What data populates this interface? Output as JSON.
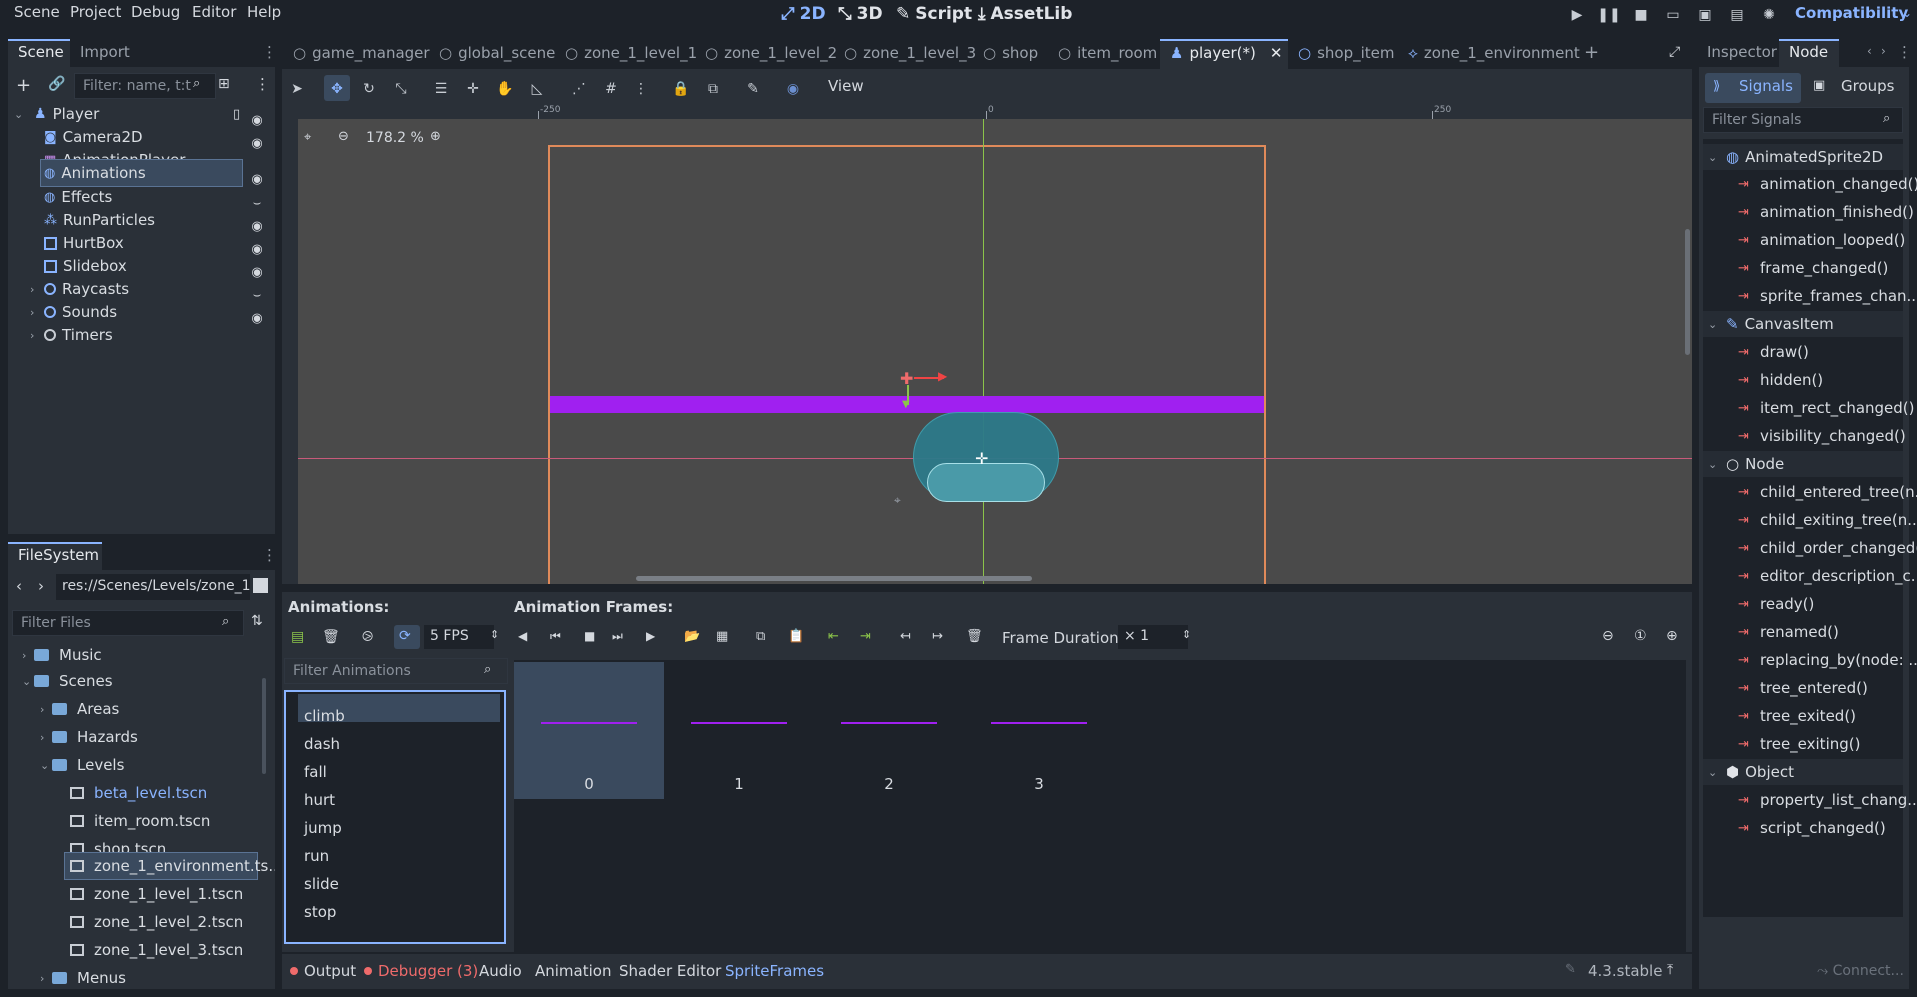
{
  "menu": [
    "Scene",
    "Project",
    "Debug",
    "Editor",
    "Help"
  ],
  "workspaces": [
    {
      "label": "2D",
      "icon": "2d-icon",
      "active": true
    },
    {
      "label": "3D",
      "icon": "3d-icon",
      "active": false
    },
    {
      "label": "Script",
      "icon": "script-icon",
      "active": false
    },
    {
      "label": "AssetLib",
      "icon": "assetlib-icon",
      "active": false
    }
  ],
  "renderer": "Compatibility",
  "scene_dock": {
    "tabs": [
      "Scene",
      "Import"
    ],
    "filter_placeholder": "Filter: name, t:t",
    "nodes": [
      {
        "label": "Player",
        "icon": "character-icon"
      },
      {
        "label": "Camera2D",
        "icon": "camera-icon"
      },
      {
        "label": "AnimationPlayer",
        "icon": "animation-player-icon"
      },
      {
        "label": "Animations",
        "icon": "animated-sprite-icon"
      },
      {
        "label": "Effects",
        "icon": "animated-sprite-icon"
      },
      {
        "label": "RunParticles",
        "icon": "particles-icon"
      },
      {
        "label": "HurtBox",
        "icon": "area-icon"
      },
      {
        "label": "Slidebox",
        "icon": "area-icon"
      },
      {
        "label": "Raycasts",
        "icon": "node-icon"
      },
      {
        "label": "Sounds",
        "icon": "node-icon"
      },
      {
        "label": "Timers",
        "icon": "node-icon"
      }
    ]
  },
  "filesystem": {
    "tab": "FileSystem",
    "path": "res://Scenes/Levels/zone_1",
    "filter_placeholder": "Filter Files",
    "items": [
      {
        "label": "Music",
        "type": "folder"
      },
      {
        "label": "Scenes",
        "type": "folder"
      },
      {
        "label": "Areas",
        "type": "folder"
      },
      {
        "label": "Hazards",
        "type": "folder"
      },
      {
        "label": "Levels",
        "type": "folder"
      },
      {
        "label": "beta_level.tscn",
        "type": "scene"
      },
      {
        "label": "item_room.tscn",
        "type": "scene"
      },
      {
        "label": "shop.tscn",
        "type": "scene"
      },
      {
        "label": "zone_1_environment.ts...",
        "type": "scene"
      },
      {
        "label": "zone_1_level_1.tscn",
        "type": "scene"
      },
      {
        "label": "zone_1_level_2.tscn",
        "type": "scene"
      },
      {
        "label": "zone_1_level_3.tscn",
        "type": "scene"
      },
      {
        "label": "Menus",
        "type": "folder"
      }
    ]
  },
  "scene_tabs": [
    "game_manager",
    "global_scene",
    "zone_1_level_1",
    "zone_1_level_2",
    "zone_1_level_3",
    "shop",
    "item_room",
    "player(*)",
    "shop_item",
    "zone_1_environment"
  ],
  "viewport": {
    "zoom": "178.2 %",
    "view_label": "View",
    "ruler_labels": [
      "-250",
      "0",
      "250"
    ]
  },
  "sprite_frames": {
    "animations_title": "Animations:",
    "frames_title": "Animation Frames:",
    "fps": "5 FPS",
    "filter_placeholder": "Filter Animations",
    "frame_duration_label": "Frame Duration:",
    "frame_duration_value": "× 1",
    "animations": [
      "climb",
      "dash",
      "fall",
      "hurt",
      "jump",
      "run",
      "slide",
      "stop"
    ],
    "frames": [
      "0",
      "1",
      "2",
      "3"
    ]
  },
  "bottom_tabs": [
    "Output",
    "Debugger (3)",
    "Audio",
    "Animation",
    "Shader Editor",
    "SpriteFrames"
  ],
  "version": "4.3.stable",
  "inspector": {
    "tabs": [
      "Inspector",
      "Node"
    ],
    "subtabs": [
      "Signals",
      "Groups"
    ],
    "filter_placeholder": "Filter Signals",
    "sections": [
      {
        "label": "AnimatedSprite2D",
        "signals": [
          "animation_changed()",
          "animation_finished()",
          "animation_looped()",
          "frame_changed()",
          "sprite_frames_chan..."
        ]
      },
      {
        "label": "CanvasItem",
        "signals": [
          "draw()",
          "hidden()",
          "item_rect_changed()",
          "visibility_changed()"
        ]
      },
      {
        "label": "Node",
        "signals": [
          "child_entered_tree(n...",
          "child_exiting_tree(n...",
          "child_order_changed()",
          "editor_description_c...",
          "ready()",
          "renamed()",
          "replacing_by(node: ...",
          "tree_entered()",
          "tree_exited()",
          "tree_exiting()"
        ]
      },
      {
        "label": "Object",
        "signals": [
          "property_list_chang...",
          "script_changed()"
        ]
      }
    ],
    "connect_label": "Connect..."
  },
  "colors": {
    "accent": "#8ab4ff",
    "selection": "#3a4a5e",
    "signal": "#ef6b6b",
    "purple": "#a020f0",
    "frame_border": "#e08a5a"
  }
}
